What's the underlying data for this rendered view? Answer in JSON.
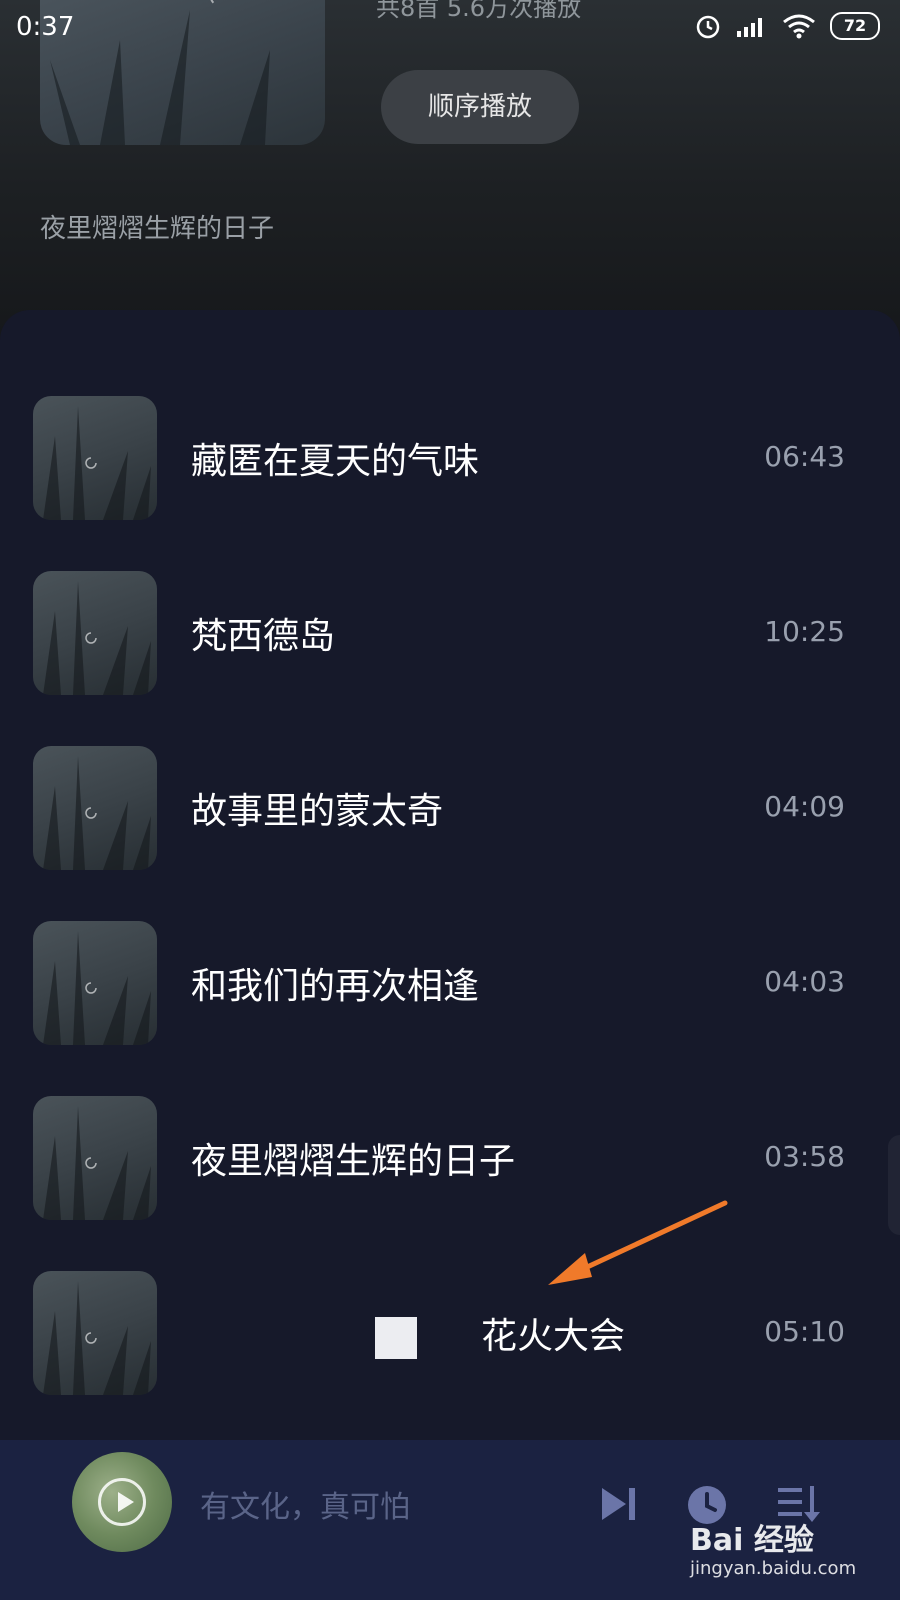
{
  "status_bar": {
    "time": "0:37",
    "battery": "72",
    "icons": [
      "alarm-icon",
      "signal-icon",
      "wifi-icon",
      "battery-icon"
    ]
  },
  "playlist": {
    "stats": "共8首  5.6万次播放",
    "play_order_label": "顺序播放",
    "description": "夜里熠熠生辉的日子"
  },
  "songs": [
    {
      "title": "藏匿在夏天的气味",
      "duration": "06:43"
    },
    {
      "title": "梵西德岛",
      "duration": "10:25"
    },
    {
      "title": "故事里的蒙太奇",
      "duration": "04:09"
    },
    {
      "title": "和我们的再次相逢",
      "duration": "04:03"
    },
    {
      "title": "夜里熠熠生辉的日子",
      "duration": "03:58"
    },
    {
      "title": "花火大会",
      "duration": "05:10"
    }
  ],
  "player": {
    "now_playing": "有文化，真可怕",
    "icons": [
      "next-icon",
      "timer-icon",
      "playlist-icon"
    ]
  },
  "watermark": {
    "brand": "Bai 经验",
    "url": "jingyan.baidu.com"
  },
  "colors": {
    "background": "#16192a",
    "player_bar": "#1b2241",
    "accent": "#6b75a8",
    "arrow": "#f07a2a"
  }
}
